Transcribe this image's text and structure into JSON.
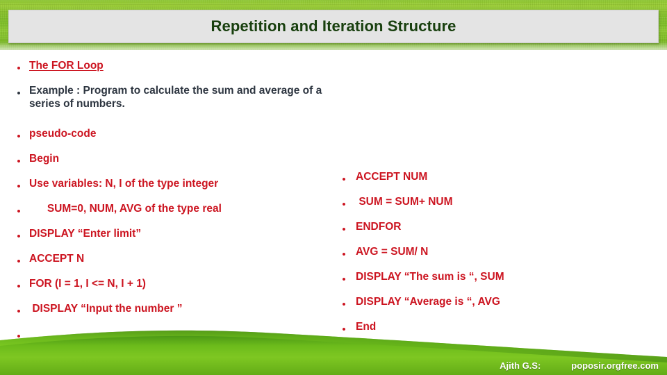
{
  "slide": {
    "title": "Repetition and Iteration Structure",
    "title_color": "#19400f",
    "accent_red": "#cc1420",
    "body_dark": "#2d3540",
    "title_box_color": "#e4e4e4",
    "bullet_glyph": "•"
  },
  "left_column": [
    {
      "text": "The FOR Loop",
      "style": "red-underline"
    },
    {
      "text": "Example : Program to calculate the sum and average of a series of numbers.",
      "style": "dark"
    },
    {
      "text": "pseudo-code",
      "style": "red"
    },
    {
      "text": "Begin",
      "style": "red"
    },
    {
      "text": "Use variables: N, I of the type integer",
      "style": "red"
    },
    {
      "text": "      SUM=0, NUM, AVG of the type real",
      "style": "red"
    },
    {
      "text": "DISPLAY “Enter limit”",
      "style": "red"
    },
    {
      "text": "ACCEPT N",
      "style": "red"
    },
    {
      "text": "FOR (I = 1, I <= N, I + 1)",
      "style": "red"
    },
    {
      "text": " DISPLAY “Input the number ”",
      "style": "red"
    },
    {
      "text": "",
      "style": "red"
    }
  ],
  "right_column": [
    {
      "text": "ACCEPT NUM",
      "style": "red"
    },
    {
      "text": " SUM = SUM+ NUM",
      "style": "red"
    },
    {
      "text": "ENDFOR",
      "style": "red"
    },
    {
      "text": "AVG = SUM/ N",
      "style": "red"
    },
    {
      "text": "DISPLAY “The sum is “, SUM",
      "style": "red"
    },
    {
      "text": "DISPLAY “Average is “, AVG",
      "style": "red"
    },
    {
      "text": "End",
      "style": "red"
    }
  ],
  "footer": {
    "author": "Ajith G.S:",
    "site": "poposir.orgfree.com"
  }
}
